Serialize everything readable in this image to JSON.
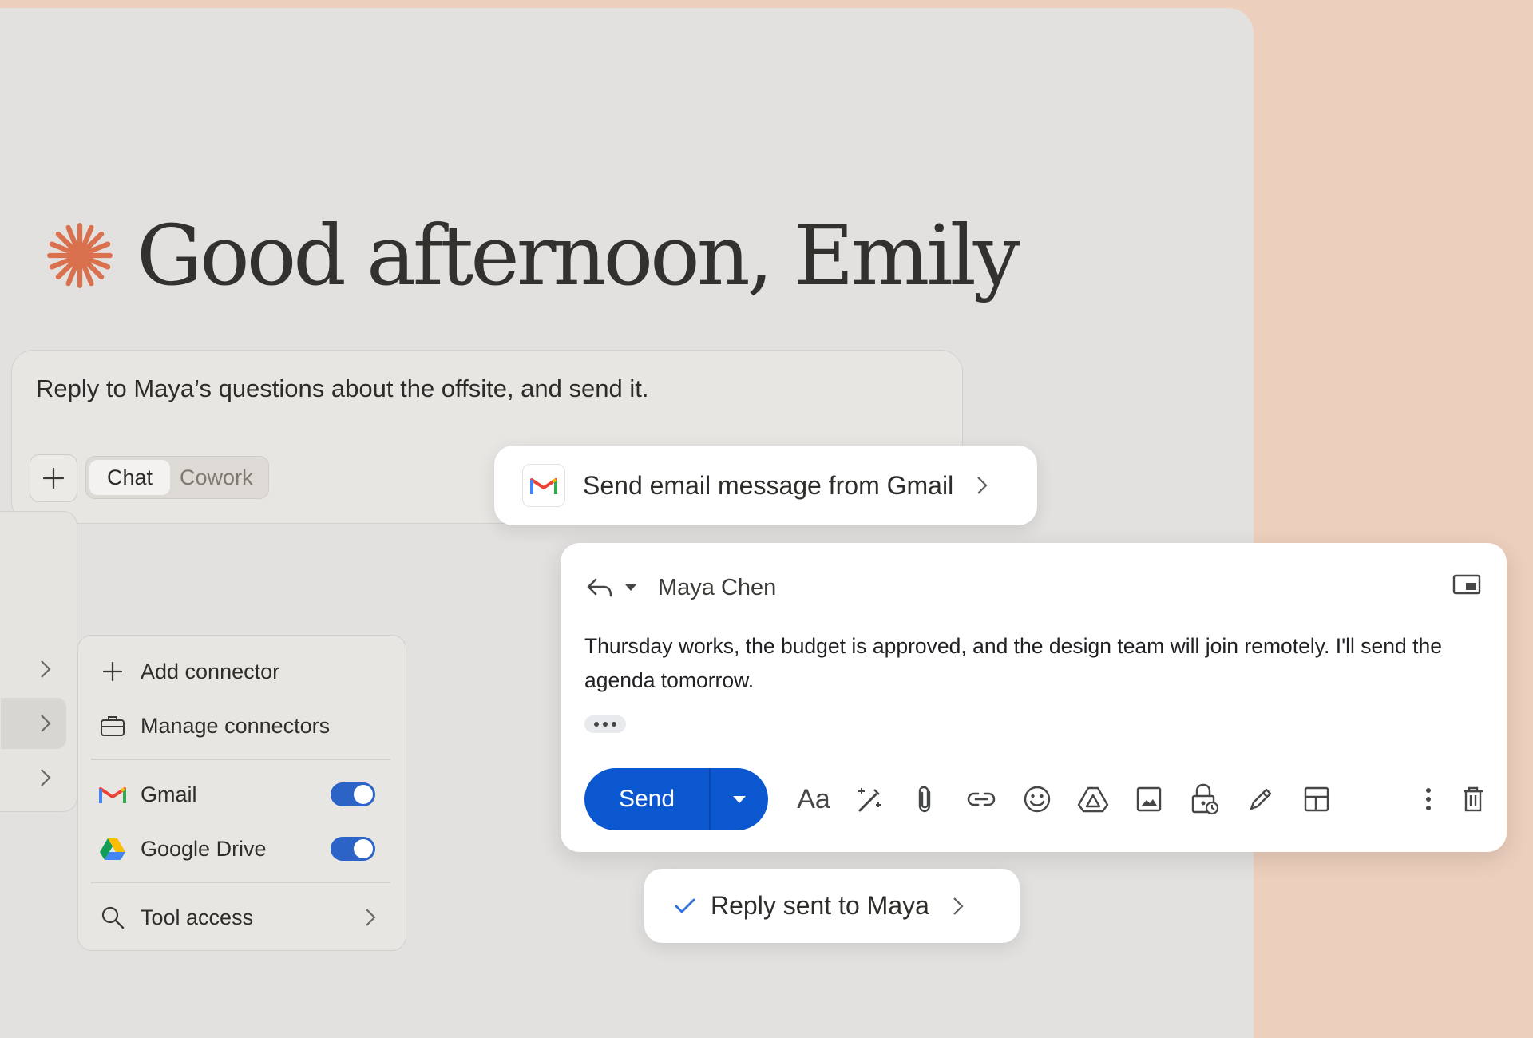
{
  "greeting": {
    "text": "Good afternoon, Emily"
  },
  "prompt": {
    "text": "Reply to Maya’s questions about the offsite, and send it.",
    "modes": [
      "Chat",
      "Cowork"
    ]
  },
  "connector_menu": {
    "add_label": "Add connector",
    "manage_label": "Manage connectors",
    "connectors": [
      {
        "label": "Gmail",
        "enabled": true
      },
      {
        "label": "Google Drive",
        "enabled": true
      }
    ],
    "tool_access_label": "Tool access"
  },
  "tool_call": {
    "label": "Send email message from Gmail"
  },
  "email": {
    "recipient": "Maya Chen",
    "body": "Thursday works, the budget is approved, and the design team will join remotely. I'll send the agenda tomorrow.",
    "send_label": "Send",
    "format_label": "Aa"
  },
  "result": {
    "label": "Reply sent to Maya"
  },
  "colors": {
    "background": "#edcfbd",
    "accent_star": "#d9714f",
    "send_blue": "#0b57d0",
    "toggle_blue": "#2b63c7",
    "check_blue": "#2f6fdc"
  }
}
